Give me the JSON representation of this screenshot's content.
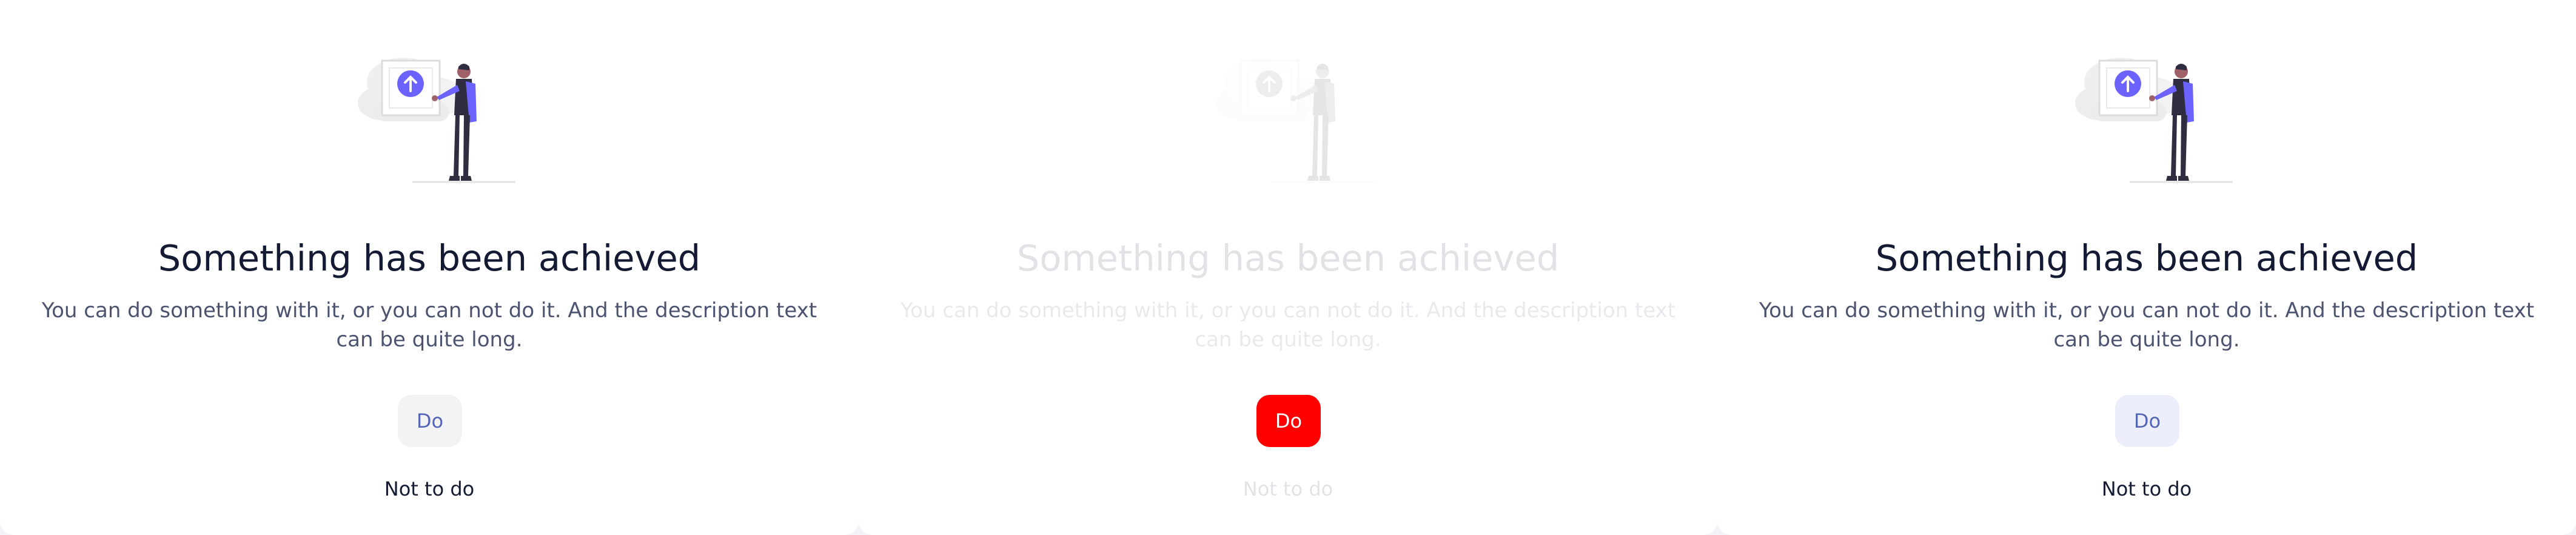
{
  "colors": {
    "accent": "#6c63ff",
    "title": "#141a33",
    "description": "#4c5370",
    "button_text": "#5566b6",
    "button_danger": "#ff0000"
  },
  "panels": [
    {
      "state": "default",
      "title": "Something has been achieved",
      "description": "You can do something with it, or you can not do it. And the description text can be quite long.",
      "primary_button": "Do",
      "secondary_link": "Not to do",
      "illustration_icon": "arrow-up-circle-icon"
    },
    {
      "state": "disabled",
      "title": "Something has been achieved",
      "description": "You can do something with it, or you can not do it. And the description text can be quite long.",
      "primary_button": "Do",
      "secondary_link": "Not to do",
      "illustration_icon": "arrow-up-circle-icon"
    },
    {
      "state": "hover",
      "title": "Something has been achieved",
      "description": "You can do something with it, or you can not do it. And the description text can be quite long.",
      "primary_button": "Do",
      "secondary_link": "Not to do",
      "illustration_icon": "arrow-up-circle-icon"
    }
  ]
}
